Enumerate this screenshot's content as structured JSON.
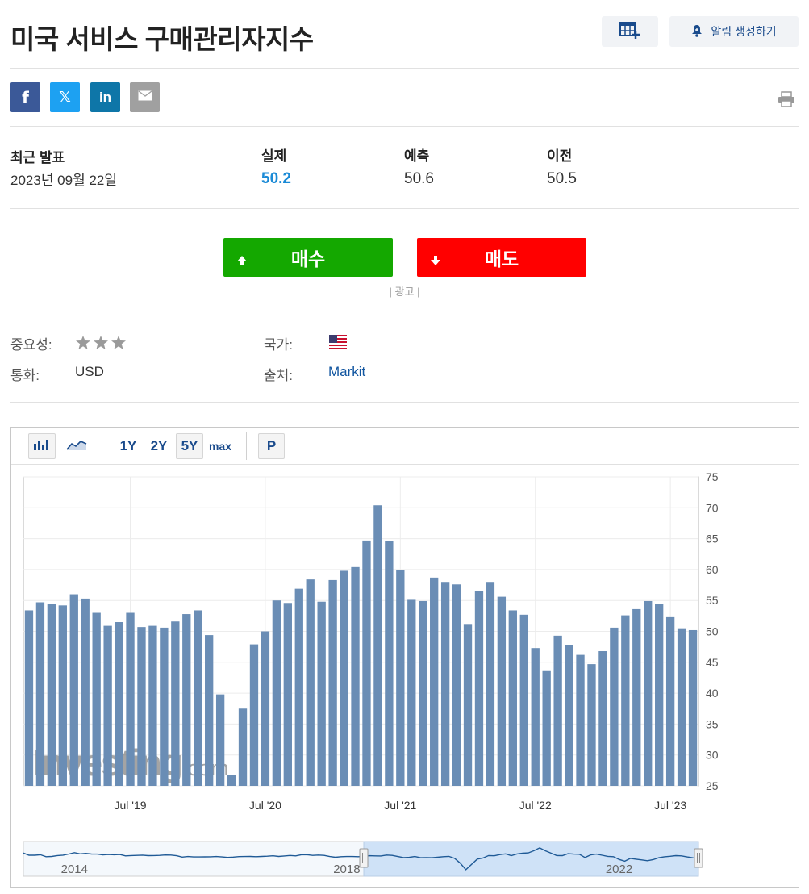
{
  "page": {
    "title": "미국 서비스 구매관리자지수",
    "alert_label": "알림 생성하기"
  },
  "icons": {
    "calendar_add": "calendar-add-icon",
    "bell": "bell-icon",
    "facebook": "facebook-icon",
    "twitter": "x-twitter-icon",
    "linkedin": "linkedin-icon",
    "email": "email-icon",
    "print": "print-icon"
  },
  "share": {
    "facebook": "f",
    "twitter": "𝕏",
    "linkedin": "in"
  },
  "release": {
    "label": "최근 발표",
    "date": "2023년 09월 22일",
    "actual_label": "실제",
    "actual_value": "50.2",
    "forecast_label": "예측",
    "forecast_value": "50.6",
    "previous_label": "이전",
    "previous_value": "50.5"
  },
  "trade": {
    "buy_label": "매수",
    "sell_label": "매도",
    "ad_label": "| 광고 |"
  },
  "info": {
    "importance_label": "중요성:",
    "importance_stars": 3,
    "country_label": "국가:",
    "currency_label": "통화:",
    "currency_value": "USD",
    "source_label": "출처:",
    "source_value": "Markit"
  },
  "colors": {
    "buy": "#14a800",
    "sell": "#ff0000",
    "actual": "#1a8ad6",
    "bar": "#6a8db5",
    "navigator_fill": "#cfe2f7",
    "navigator_line": "#1f5a96"
  },
  "chart_toolbar": {
    "ranges": [
      "1Y",
      "2Y",
      "5Y",
      "max"
    ],
    "selected_range": "5Y",
    "p_label": "P"
  },
  "chart_data": {
    "type": "bar",
    "x": [
      "2018-10",
      "2018-11",
      "2018-12",
      "2019-01",
      "2019-02",
      "2019-03",
      "2019-04",
      "2019-05",
      "2019-06",
      "2019-07",
      "2019-08",
      "2019-09",
      "2019-10",
      "2019-11",
      "2019-12",
      "2020-01",
      "2020-02",
      "2020-03",
      "2020-04",
      "2020-05",
      "2020-06",
      "2020-07",
      "2020-08",
      "2020-09",
      "2020-10",
      "2020-11",
      "2020-12",
      "2021-01",
      "2021-02",
      "2021-03",
      "2021-04",
      "2021-05",
      "2021-06",
      "2021-07",
      "2021-08",
      "2021-09",
      "2021-10",
      "2021-11",
      "2021-12",
      "2022-01",
      "2022-02",
      "2022-03",
      "2022-04",
      "2022-05",
      "2022-06",
      "2022-07",
      "2022-08",
      "2022-09",
      "2022-10",
      "2022-11",
      "2022-12",
      "2023-01",
      "2023-02",
      "2023-03",
      "2023-04",
      "2023-05",
      "2023-06",
      "2023-07",
      "2023-08",
      "2023-09"
    ],
    "values": [
      53.4,
      54.7,
      54.4,
      54.2,
      56.0,
      55.3,
      53.0,
      50.9,
      51.5,
      53.0,
      50.7,
      50.9,
      50.6,
      51.6,
      52.8,
      53.4,
      49.4,
      39.8,
      26.7,
      37.5,
      47.9,
      50.0,
      55.0,
      54.6,
      56.9,
      58.4,
      54.8,
      58.3,
      59.8,
      60.4,
      64.7,
      70.4,
      64.6,
      59.9,
      55.1,
      54.9,
      58.7,
      58.0,
      57.6,
      51.2,
      56.5,
      58.0,
      55.6,
      53.4,
      52.7,
      47.3,
      43.7,
      49.3,
      47.8,
      46.2,
      44.7,
      46.8,
      50.6,
      52.6,
      53.6,
      54.9,
      54.4,
      52.3,
      50.5,
      50.2
    ],
    "x_ticks": [
      "Jul '19",
      "Jul '20",
      "Jul '21",
      "Jul '22",
      "Jul '23"
    ],
    "y_ticks": [
      25,
      30,
      35,
      40,
      45,
      50,
      55,
      60,
      65,
      70,
      75
    ],
    "ylim": [
      25,
      75
    ],
    "grid": true,
    "watermark": "Investing.com",
    "navigator": {
      "labels": [
        "2014",
        "2018",
        "2022"
      ],
      "range_start": "2013-10",
      "range_end": "2023-09",
      "selected_start": "2018-10",
      "selected_end": "2023-09",
      "values": [
        60.1,
        55.6,
        55.7,
        56.7,
        52.7,
        53.3,
        55.0,
        55.9,
        58.1,
        60.8,
        58.5,
        59.4,
        58.1,
        57.9,
        56.5,
        57.1,
        56.7,
        57.2,
        54.3,
        55.0,
        55.4,
        55.8,
        54.9,
        55.1,
        55.3,
        56.1,
        56.0,
        54.7,
        51.9,
        53.0,
        52.3,
        52.3,
        52.4,
        52.6,
        53.0,
        52.3,
        51.3,
        51.9,
        52.9,
        53.0,
        53.2,
        52.8,
        53.3,
        53.8,
        54.6,
        53.3,
        54.2,
        55.2,
        54.3,
        56.7,
        56.6,
        55.3,
        56.0,
        55.4,
        53.0,
        51.6,
        52.7,
        53.0,
        53.0,
        52.8,
        53.4,
        54.7,
        54.4,
        54.2,
        56.0,
        55.3,
        53.0,
        50.9,
        51.5,
        53.0,
        50.7,
        50.9,
        50.6,
        51.6,
        52.8,
        53.4,
        49.4,
        39.8,
        26.7,
        37.5,
        47.9,
        50.0,
        55.0,
        54.6,
        56.9,
        58.4,
        54.8,
        58.3,
        59.8,
        60.4,
        64.7,
        70.4,
        64.6,
        59.9,
        55.1,
        54.9,
        58.7,
        58.0,
        57.6,
        51.2,
        56.5,
        58.0,
        55.6,
        53.4,
        52.7,
        47.3,
        43.7,
        49.3,
        47.8,
        46.2,
        44.7,
        46.8,
        50.6,
        52.6,
        53.6,
        54.9,
        54.4,
        52.3,
        50.5,
        50.2
      ]
    }
  }
}
